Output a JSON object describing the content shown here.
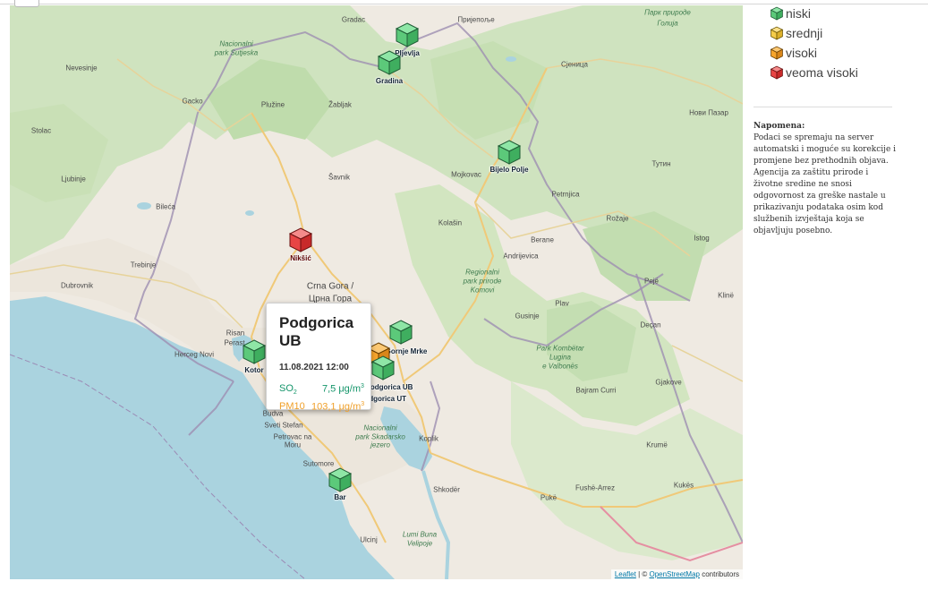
{
  "legend": {
    "items": [
      {
        "label": "niski",
        "color": "#6fd38a"
      },
      {
        "label": "srednji",
        "color": "#f5cc4a"
      },
      {
        "label": "visoki",
        "color": "#f7a52c"
      },
      {
        "label": "veoma visoki",
        "color": "#e84545"
      }
    ]
  },
  "note": {
    "heading": "Napomena:",
    "text": "Podaci se spremaju na server automatski i moguće su korekcije i promjene bez prethodnih objava. Agencija za zaštitu prirode i životne sredine ne snosi odgovornost za greške nastale u prikazivanju podataka osim kod službenih izvještaja koja se objavljuju posebno."
  },
  "map": {
    "places": [
      "Gradac",
      "Пријепоље",
      "Парк природе",
      "Голија",
      "Nacionalni",
      "park Sutjeska",
      "Сјеница",
      "Nevesinje",
      "Gacko",
      "Plužine",
      "Žabljak",
      "Нови Пазар",
      "Stolac",
      "Šavnik",
      "Mojkovac",
      "Тутин",
      "Ljubinje",
      "Bileća",
      "Petrnjica",
      "Kolašin",
      "Berane",
      "Rožaje",
      "Istog",
      "Trebinje",
      "Andrijevica",
      "Dubrovnik",
      "Regionalni",
      "park prirode",
      "Komovi",
      "Pejë",
      "Crna Gora /",
      "Црна Гора",
      "Klinë",
      "Gusinje",
      "Plav",
      "Deçan",
      "Risan",
      "Perast",
      "Herceg Novi",
      "Park Kombëtar",
      "Lugina",
      "e Valbonës",
      "Bajram Curri",
      "Gjakove",
      "Budva",
      "Sveti Stefan",
      "Petrovac na",
      "Moru",
      "Nacionalni",
      "park Skadarsko",
      "jezero",
      "Koplik",
      "Krumë",
      "Sutomore",
      "Shkodër",
      "Pukë",
      "Fushë-Arrez",
      "Kukës",
      "Ulcinj",
      "Lumi Buna",
      "Velipoje"
    ],
    "stations": [
      {
        "name": "Pljevlja",
        "level": "niski"
      },
      {
        "name": "Gradina",
        "level": "niski"
      },
      {
        "name": "Bijelo Polje",
        "level": "niski"
      },
      {
        "name": "Nikšić",
        "level": "veoma visoki"
      },
      {
        "name": "Kotor",
        "level": "niski"
      },
      {
        "name": "Gornje Mrke",
        "level": "niski"
      },
      {
        "name": "Podgorica UB",
        "level": "visoki"
      },
      {
        "name": "Podgorica UT",
        "level": "niski"
      },
      {
        "name": "Bar",
        "level": "niski"
      }
    ],
    "attribution": {
      "leaflet": "Leaflet",
      "sep": " | © ",
      "osm": "OpenStreetMap",
      "tail": " contributors"
    }
  },
  "popup": {
    "title": "Podgorica UB",
    "datetime": "11.08.2021 12:00",
    "rows": [
      {
        "pollutant": "SO",
        "sub": "2",
        "value": "7,5 μg/m",
        "sup": "3",
        "color": "#14956a"
      },
      {
        "pollutant": "PM10",
        "sub": "",
        "value": "103,1 μg/m",
        "sup": "3",
        "color": "#f0a02a"
      }
    ]
  }
}
